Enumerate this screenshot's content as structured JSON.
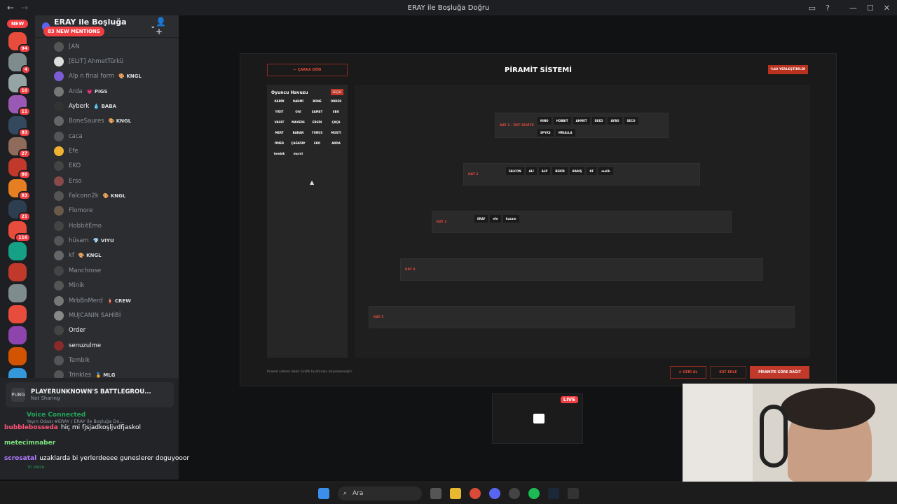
{
  "window": {
    "title": "ERAY ile Boşluğa Doğru"
  },
  "sidebar": {
    "new_top": "NEW",
    "new_bottom": "NEW",
    "badges": [
      "94",
      "4",
      "10",
      "11",
      "83",
      "27",
      "80",
      "83",
      "21",
      "116"
    ]
  },
  "server": {
    "name": "ERAY ile Boşluğa Doğru",
    "new_mentions": "83 NEW MENTIONS"
  },
  "members": [
    {
      "name": "[AN",
      "tag": ""
    },
    {
      "name": "[ELIT] AhmetTürkü",
      "tag": ""
    },
    {
      "name": "Alp n final form",
      "tag": "🎨 KNGL"
    },
    {
      "name": "Arda",
      "tag": "💗 PIGS"
    },
    {
      "name": "Ayberk",
      "tag": "💧 BABA"
    },
    {
      "name": "BoneSaures",
      "tag": "🎨 KNGL"
    },
    {
      "name": "caca",
      "tag": ""
    },
    {
      "name": "Efe",
      "tag": ""
    },
    {
      "name": "EKO",
      "tag": ""
    },
    {
      "name": "Erso",
      "tag": ""
    },
    {
      "name": "Falconn2k",
      "tag": "🎨 KNGL"
    },
    {
      "name": "Flomore",
      "tag": ""
    },
    {
      "name": "HobbitEmo",
      "tag": ""
    },
    {
      "name": "hüsam",
      "tag": "💎 VIYU"
    },
    {
      "name": "kf",
      "tag": "🎨 KNGL"
    },
    {
      "name": "Manchrose",
      "tag": ""
    },
    {
      "name": "Minik",
      "tag": ""
    },
    {
      "name": "MrbBnMerd",
      "tag": "🧯 CREW"
    },
    {
      "name": "MUJCANIN SAHİBİ",
      "tag": ""
    },
    {
      "name": "Order",
      "tag": ""
    },
    {
      "name": "senuzulme",
      "tag": ""
    },
    {
      "name": "Tembik",
      "tag": ""
    },
    {
      "name": "Trinkles",
      "tag": "🏅 MLG"
    }
  ],
  "activity": {
    "game": "PLAYERUNKNOWN'S BATTLEGROU...",
    "status": "Not Sharing"
  },
  "voice": {
    "status": "Voice Connected",
    "room": "Yayın Odası #ERAY / ERAY ile Boşluğa Do...",
    "in_voice": "In voice"
  },
  "chat": [
    {
      "user": "bubblebosseda",
      "text": "hiç mi fjsjadkoşljvdfjaskol"
    },
    {
      "user": "metecimnaber",
      "text": ""
    },
    {
      "user": "scrosatal",
      "text": "uzaklarda bi yerlerdeeee guneslerer doguyooor"
    }
  ],
  "app": {
    "back": "← ÇARKA DÖN",
    "title": "PİRAMİT SİSTEMİ",
    "sort": "%40 YERLEŞTİRİLDİ",
    "pool_title": "Oyuncu Havuzu",
    "pool_select": "SEÇİLİ",
    "pool": [
      "KADİR",
      "RAHMİ",
      "BONE",
      "ORDER",
      "YİĞİT",
      "OGİ",
      "SAMET",
      "EBO",
      "VAULT",
      "MAXERS",
      "ERSİN",
      "ÇAÇA",
      "MERT",
      "BARAN",
      "YUNUS",
      "MUSTİ",
      "ÖMER",
      "ÇAĞATAY",
      "EKO",
      "ARDA",
      "tembik",
      "murat"
    ],
    "tiers": [
      {
        "label": "KAT 1 - ÜST SEVİYE",
        "chips": [
          "NINO",
          "HOBBIT",
          "AHMET",
          "DEIZI",
          "AYBO",
          "SECO",
          "SPYKS",
          "MİRALLA"
        ]
      },
      {
        "label": "KAT 2",
        "chips": [
          "FALCON",
          "ALİ",
          "ALP",
          "BEKİR",
          "BARIŞ",
          "KF",
          "melih"
        ]
      },
      {
        "label": "KAT 3",
        "chips": [
          "ERAY",
          "efe",
          "husam"
        ]
      },
      {
        "label": "KAT 4",
        "chips": []
      },
      {
        "label": "KAT 5",
        "chips": []
      }
    ],
    "note": "Piramit sistemi Bebir Grafik tarafından düzenlenmiştir.",
    "btn_reset": "↺ GERİ AL",
    "btn_add": "KAT EKLE",
    "btn_distribute": "PİRAMİTE GÖRE DAĞIT"
  },
  "live_label": "LIVE",
  "taskbar": {
    "search": "Ara"
  },
  "colors": {
    "accent": "#c0392b",
    "discord_red": "#f23f43",
    "voice_green": "#23a55a"
  }
}
